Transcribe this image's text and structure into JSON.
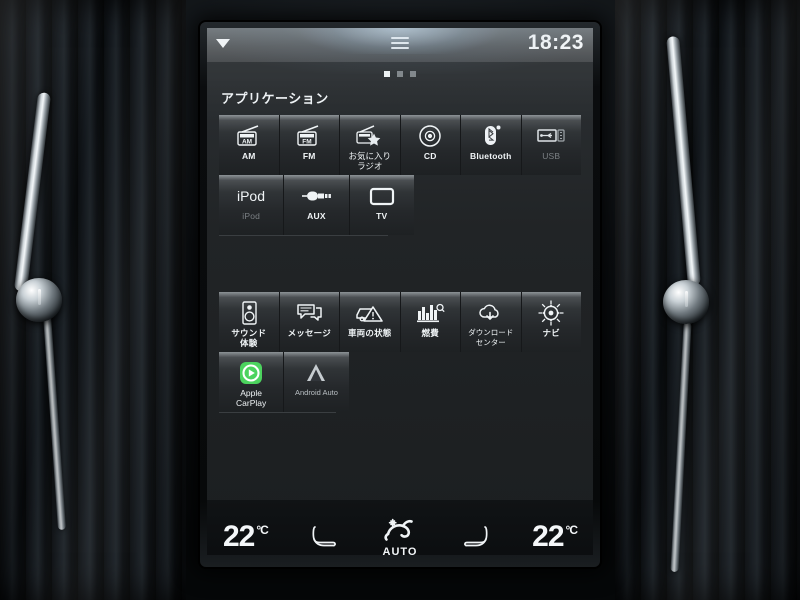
{
  "status_bar": {
    "clock": "18:23",
    "back_icon": "triangle-down-icon",
    "handle_icon": "hamburger-handle-icon"
  },
  "page_indicator": {
    "total": 3,
    "active": 1
  },
  "screen": {
    "title": "アプリケーション"
  },
  "app_groups": [
    {
      "name": "media-sources",
      "rows": [
        [
          {
            "label": "AM",
            "icon": "radio-am-icon",
            "dim": false
          },
          {
            "label": "FM",
            "icon": "radio-fm-icon",
            "dim": false
          },
          {
            "label": "お気に入り\nラジオ",
            "icon": "favorite-radio-icon",
            "dim": false
          },
          {
            "label": "CD",
            "icon": "cd-disc-icon",
            "dim": false
          },
          {
            "label": "Bluetooth",
            "icon": "bluetooth-icon",
            "dim": false
          },
          {
            "label": "USB",
            "icon": "usb-icon",
            "dim": true
          }
        ],
        [
          {
            "label": "iPod",
            "icon": "ipod-text-icon",
            "dim": true
          },
          {
            "label": "AUX",
            "icon": "aux-jack-icon",
            "dim": false
          },
          {
            "label": "TV",
            "icon": "tv-screen-icon",
            "dim": false
          }
        ]
      ]
    },
    {
      "name": "vehicle-apps",
      "rows": [
        [
          {
            "label": "サウンド\n体験",
            "icon": "speaker-icon",
            "dim": false
          },
          {
            "label": "メッセージ",
            "icon": "message-bubble-icon",
            "dim": false
          },
          {
            "label": "車両の状態",
            "icon": "car-warning-icon",
            "dim": false
          },
          {
            "label": "燃費",
            "icon": "fuel-chart-icon",
            "dim": false
          },
          {
            "label": "ダウンロード\nセンター",
            "icon": "cloud-download-icon",
            "dim": false
          },
          {
            "label": "ナビ",
            "icon": "compass-icon",
            "dim": false
          }
        ],
        [
          {
            "label": "Apple\nCarPlay",
            "icon": "apple-carplay-icon",
            "dim": false
          },
          {
            "label": "Android Auto",
            "icon": "android-auto-icon",
            "dim": true
          }
        ]
      ]
    }
  ],
  "climate": {
    "left_temp": "22",
    "left_unit": "°C",
    "right_temp": "22",
    "right_unit": "°C",
    "left_seat_icon": "seat-heat-left-icon",
    "right_seat_icon": "seat-heat-right-icon",
    "fan_icon": "fan-auto-icon",
    "fan_label": "AUTO"
  },
  "colors": {
    "screen_bg": "#22262a",
    "accent_text": "#f0f4f6",
    "dim_text": "#7b8084",
    "carplay_green": "#4cd35e"
  }
}
